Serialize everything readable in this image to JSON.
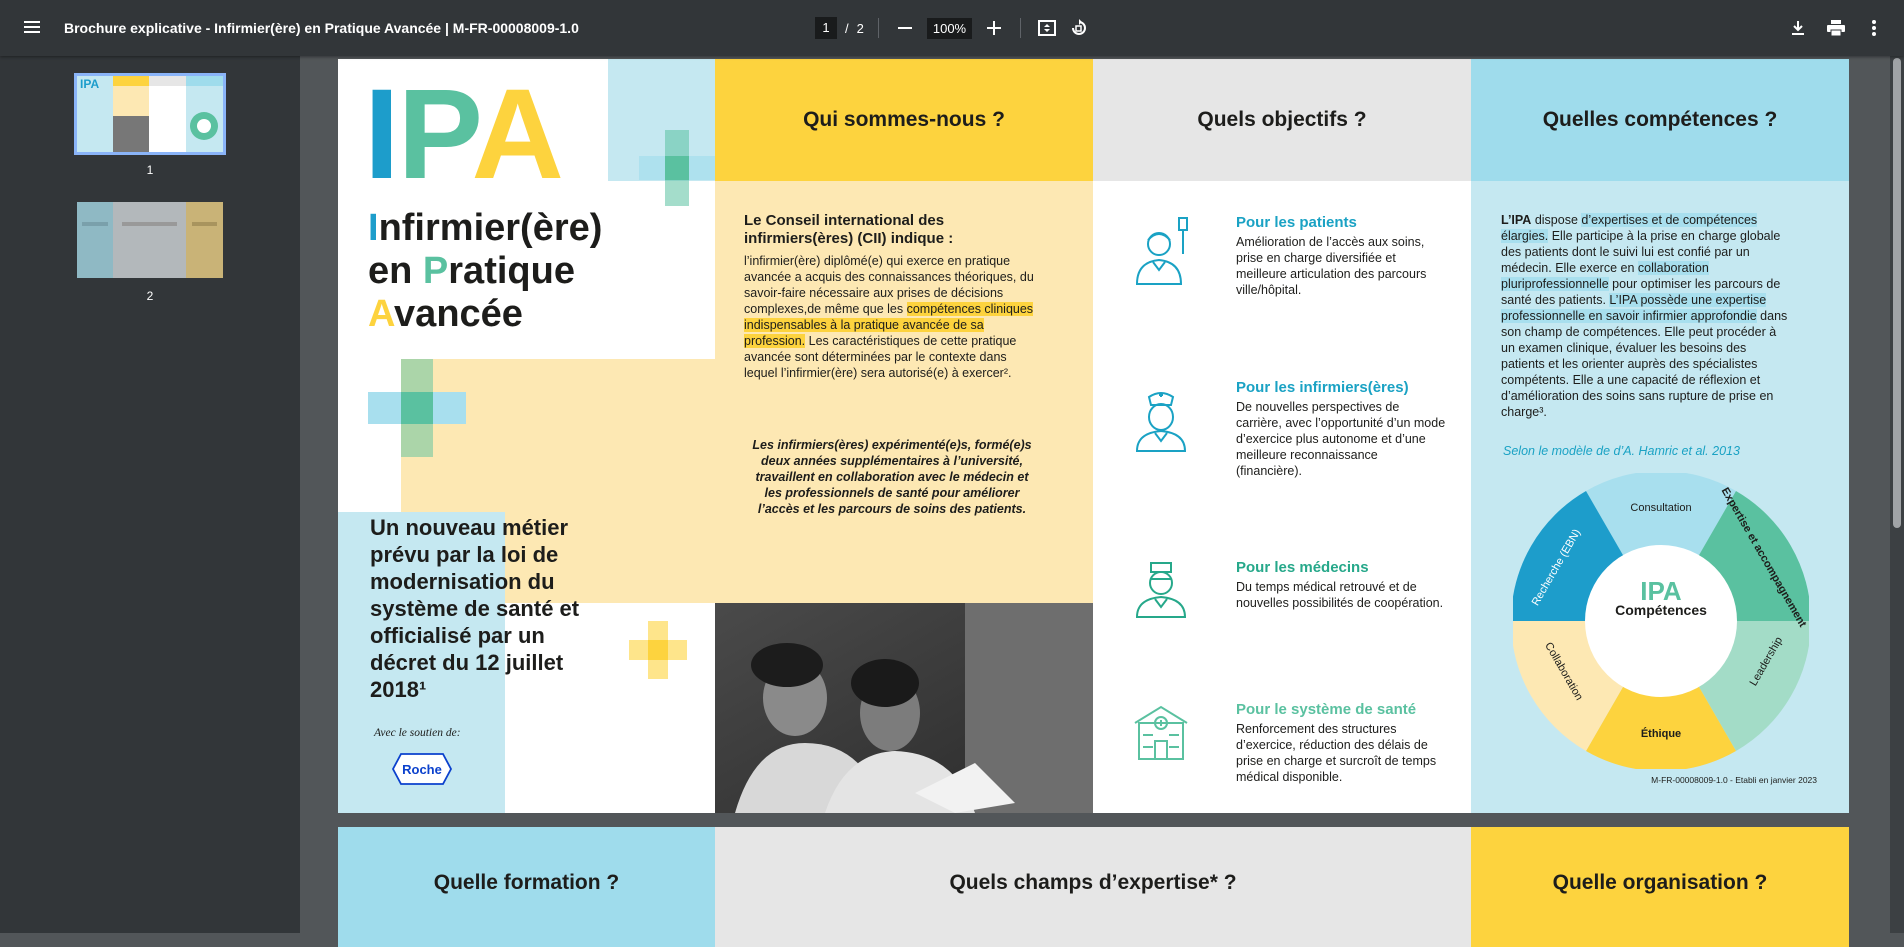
{
  "toolbar": {
    "title": "Brochure explicative - Infirmier(ère) en Pratique Avancée | M-FR-00008009-1.0",
    "current_page": "1",
    "page_separator": "/",
    "total_pages": "2",
    "zoom": "100%",
    "icons": [
      "menu-icon",
      "zoom-out-icon",
      "zoom-in-icon",
      "fit-page-icon",
      "rotate-icon",
      "download-icon",
      "print-icon",
      "more-icon"
    ]
  },
  "sidebar": {
    "thumbnails": [
      {
        "label": "1",
        "selected": true
      },
      {
        "label": "2",
        "selected": false
      }
    ]
  },
  "document": {
    "col1": {
      "ipa_letters": [
        "I",
        "P",
        "A"
      ],
      "title_line1_initial": "I",
      "title_line1_rest": "nfirmier(ère)",
      "title_line2_pre": "en ",
      "title_line2_initial": "P",
      "title_line2_rest": "ratique",
      "title_line3_initial": "A",
      "title_line3_rest": "vancée",
      "new_job": "Un nouveau métier prévu par la loi de modernisation du système de santé et officialisé par un décret du 12 juillet 2018¹",
      "support": "Avec le soutien de:",
      "logo": "Roche"
    },
    "col2": {
      "header": "Qui sommes-nous ?",
      "intro_title": "Le Conseil international des infirmiers(ères) (CII) indique :",
      "body_before": "l’infirmier(ère) diplômé(e) qui exerce en pratique avancée a acquis des connaissances théoriques, du savoir-faire nécessaire aux prises de décisions complexes,de même que les ",
      "body_highlight": "compétences cliniques indispensables à la pratique avancée de sa profession.",
      "body_after": " Les caractéristiques de cette pratique avancée sont déterminées par le contexte dans lequel l’infirmier(ère) sera autorisé(e) à exercer².",
      "quote": "Les infirmiers(ères) expérimenté(e)s, formé(e)s deux années supplémentaires à l’université, travaillent en collaboration avec le médecin et les professionnels de santé pour améliorer l’accès et les parcours de soins des patients."
    },
    "col3": {
      "header": "Quels objectifs ?",
      "items": [
        {
          "title": "Pour les patients",
          "text": "Amélioration de l’accès aux soins, prise en charge diversifiée et meilleure articulation des parcours ville/hôpital.",
          "icon": "patient-icon"
        },
        {
          "title": "Pour les infirmiers(ères)",
          "text": "De nouvelles perspectives de carrière, avec l’opportunité d’un mode d’exercice plus autonome et d’une meilleure reconnaissance (financière).",
          "icon": "nurse-icon"
        },
        {
          "title": "Pour les médecins",
          "text": "Du temps médical retrouvé et de nouvelles possibilités de coopération.",
          "icon": "doctor-icon"
        },
        {
          "title": "Pour le système de santé",
          "text": "Renforcement des structures d’exercice, réduction des délais de prise en charge et surcroît de temps médical disponible.",
          "icon": "hospital-icon"
        }
      ]
    },
    "col4": {
      "header": "Quelles compétences ?",
      "p_lead": "L’IPA",
      "p1": " dispose ",
      "p2": "d’expertises et de compétences élargies.",
      "p3": " Elle participe à la prise en charge globale des patients dont le suivi lui est confié par un médecin. Elle exerce en ",
      "p4": "collaboration pluriprofessionnelle",
      "p5": " pour optimiser les parcours de santé des patients. ",
      "p6": "L’IPA possède une expertise professionnelle en savoir infirmier approfondie",
      "p7": " dans son champ de compétences. Elle peut procéder à un examen clinique, évaluer les besoins des patients et les orienter auprès des spécialistes compétents. Elle a une capacité de réflexion et d’amélioration des soins sans rupture de prise en charge³.",
      "model_caption": "Selon le modèle de d’A. Hamric et al. 2013",
      "wheel_center_title": "Compétences",
      "wheel_center_ipa": "IPA",
      "wheel_segments": [
        "Consultation",
        "Expertise et accompagnement",
        "Leadership",
        "Éthique",
        "Collaboration",
        "Recherche (EBN)"
      ],
      "footer": "M-FR-00008009-1.0 - Etabli en janvier 2023"
    },
    "page2": {
      "headers": [
        "Quelle formation ?",
        "Quels champs d’expertise* ?",
        "Quelle organisation ?"
      ]
    },
    "colors": {
      "blue": "#1d9dcb",
      "teal": "#5ac1a0",
      "yellow": "#fdd33e",
      "light_blue": "#c5e8f1",
      "light_yellow": "#fde8b3",
      "grey": "#e6e6e6"
    }
  }
}
